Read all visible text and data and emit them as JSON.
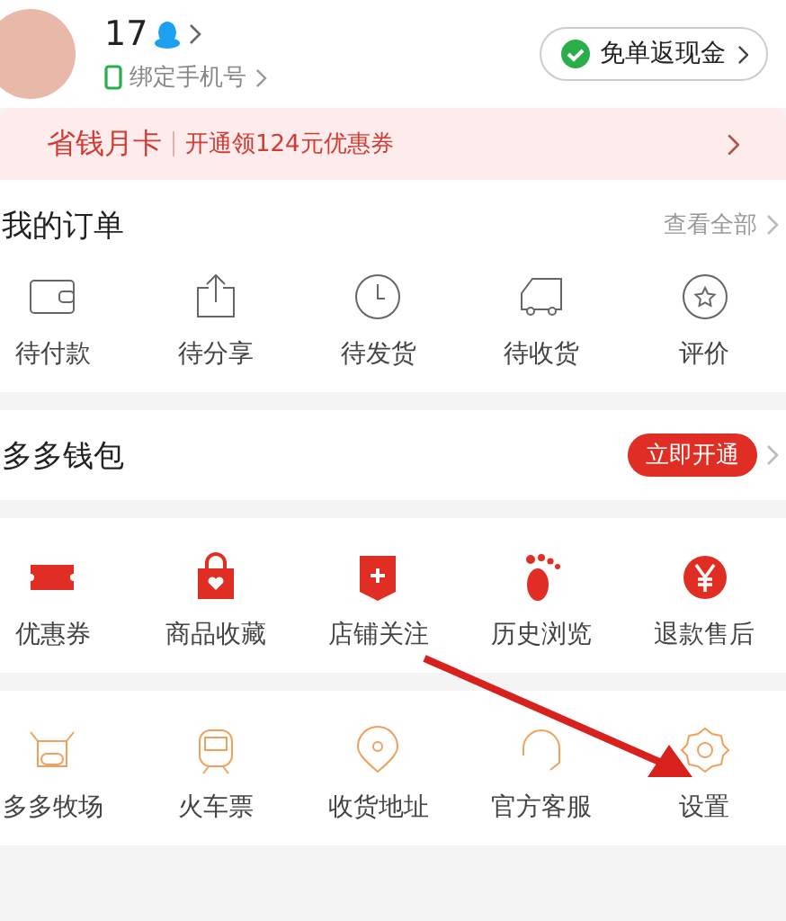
{
  "profile": {
    "name": "17",
    "phone_link": "绑定手机号",
    "cashback_button": "免单返现金"
  },
  "promo": {
    "title": "省钱月卡",
    "text": "开通领124元优惠券"
  },
  "orders": {
    "title": "我的订单",
    "view_all": "查看全部",
    "items": [
      {
        "label": "待付款"
      },
      {
        "label": "待分享"
      },
      {
        "label": "待发货"
      },
      {
        "label": "待收货"
      },
      {
        "label": "评价"
      }
    ]
  },
  "wallet": {
    "title": "多多钱包",
    "button": "立即开通"
  },
  "services": [
    {
      "label": "优惠券"
    },
    {
      "label": "商品收藏"
    },
    {
      "label": "店铺关注"
    },
    {
      "label": "历史浏览"
    },
    {
      "label": "退款售后"
    }
  ],
  "tools": [
    {
      "label": "多多牧场"
    },
    {
      "label": "火车票"
    },
    {
      "label": "收货地址"
    },
    {
      "label": "官方客服"
    },
    {
      "label": "设置"
    }
  ]
}
